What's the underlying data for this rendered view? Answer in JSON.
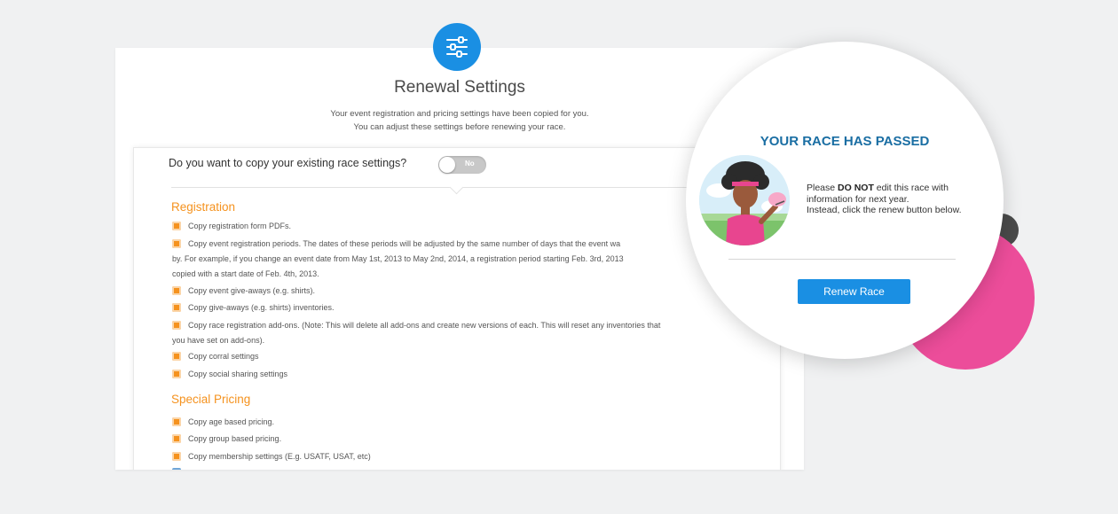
{
  "panel": {
    "title": "Renewal Settings",
    "subtitle_line1": "Your event registration and pricing settings have been copied for you.",
    "subtitle_line2": "You can adjust these settings before renewing your race."
  },
  "copy_settings": {
    "question": "Do you want to copy your existing race settings?",
    "toggle_label": "No",
    "toggle_on": false
  },
  "registration": {
    "heading": "Registration",
    "options": [
      "Copy registration form PDFs.",
      "Copy event registration periods. The dates of these periods will be adjusted by the same number of days that the event wa",
      "by. For example, if you change an event date from May 1st, 2013 to May 2nd, 2014, a registration period starting Feb. 3rd, 2013",
      "copied with a start date of Feb. 4th, 2013.",
      "Copy event give-aways (e.g. shirts).",
      "Copy give-aways (e.g. shirts) inventories.",
      "Copy race registration add-ons. (Note: This will delete all add-ons and create new versions of each. This will reset any inventories that",
      "you have set on add-ons).",
      "Copy corral settings",
      "Copy social sharing settings"
    ]
  },
  "special_pricing": {
    "heading": "Special Pricing",
    "options": [
      "Copy age based pricing.",
      "Copy group based pricing.",
      "Copy membership settings (E.g. USATF, USAT, etc)"
    ]
  },
  "callout": {
    "heading": "YOUR RACE HAS PASSED",
    "msg_prefix": "Please ",
    "msg_bold": "DO NOT",
    "msg_line1_rest": " edit this race with",
    "msg_line2": "information for next year.",
    "msg_line3": "Instead, click the renew button below.",
    "button_label": "Renew Race"
  },
  "icons": {
    "settings": "sliders-icon",
    "avatar": "runner-avatar"
  },
  "colors": {
    "accent_blue": "#1a8fe3",
    "heading_blue": "#1a6ea3",
    "section_orange": "#f5921e",
    "pink": "#ec4d9a"
  }
}
